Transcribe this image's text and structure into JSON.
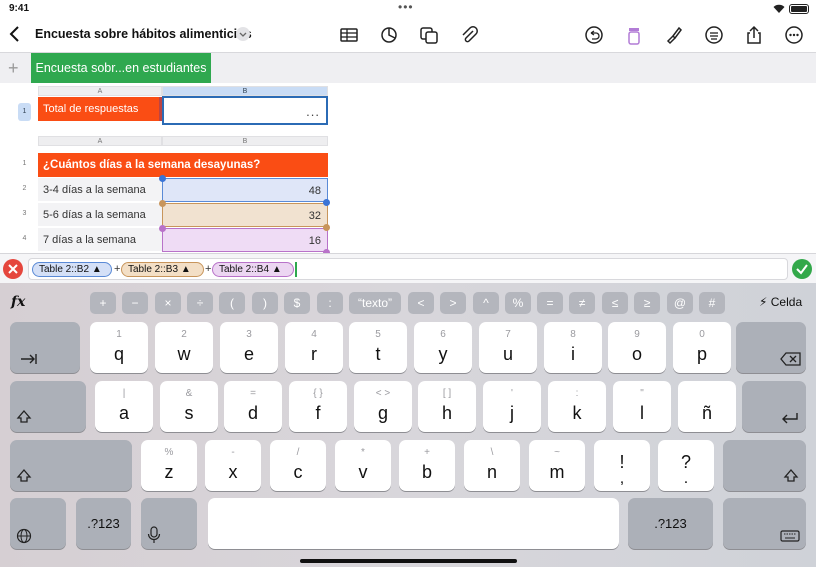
{
  "status": {
    "time": "9:41"
  },
  "toolbar": {
    "title": "Encuesta sobre hábitos alimenticios"
  },
  "sheet_tab": {
    "label": "Encuesta sobr...en estudiantes"
  },
  "table1": {
    "col_headers": [
      "A",
      "B"
    ],
    "row_header": "1",
    "label": "Total de respuestas",
    "value_placeholder": "..."
  },
  "table2": {
    "col_headers": [
      "A",
      "B"
    ],
    "header_row_num": "1",
    "header": "¿Cuántos días a la semana desayunas?",
    "rows": [
      {
        "num": "2",
        "label": "3-4 días a la semana",
        "value": "48"
      },
      {
        "num": "3",
        "label": "5-6 días a la semana",
        "value": "32"
      },
      {
        "num": "4",
        "label": "7 días a la semana",
        "value": "16"
      }
    ]
  },
  "formula": {
    "tokens": [
      "Table 2::B2",
      "Table 2::B3",
      "Table 2::B4"
    ],
    "operator": "+"
  },
  "shortcuts": {
    "keys": [
      "+",
      "−",
      "×",
      "÷",
      "(",
      ")",
      "$",
      ":",
      "“texto”",
      "<",
      ">",
      "^",
      "%",
      "=",
      "≠",
      "≤",
      "≥",
      "@",
      "#"
    ],
    "celda": "Celda"
  },
  "keyboard": {
    "row1": [
      {
        "sub": "1",
        "main": "q"
      },
      {
        "sub": "2",
        "main": "w"
      },
      {
        "sub": "3",
        "main": "e"
      },
      {
        "sub": "4",
        "main": "r"
      },
      {
        "sub": "5",
        "main": "t"
      },
      {
        "sub": "6",
        "main": "y"
      },
      {
        "sub": "7",
        "main": "u"
      },
      {
        "sub": "8",
        "main": "i"
      },
      {
        "sub": "9",
        "main": "o"
      },
      {
        "sub": "0",
        "main": "p"
      }
    ],
    "row2": [
      {
        "sub": "|",
        "main": "a"
      },
      {
        "sub": "&",
        "main": "s"
      },
      {
        "sub": "=",
        "main": "d"
      },
      {
        "sub": "{   }",
        "main": "f"
      },
      {
        "sub": "<   >",
        "main": "g"
      },
      {
        "sub": "[   ]",
        "main": "h"
      },
      {
        "sub": "'",
        "main": "j"
      },
      {
        "sub": ":",
        "main": "k"
      },
      {
        "sub": "\"",
        "main": "l"
      },
      {
        "sub": "",
        "main": "ñ"
      }
    ],
    "row3": [
      {
        "sub": "%",
        "main": "z"
      },
      {
        "sub": "-",
        "main": "x"
      },
      {
        "sub": "/",
        "main": "c"
      },
      {
        "sub": "*",
        "main": "v"
      },
      {
        "sub": "+",
        "main": "b"
      },
      {
        "sub": "\\",
        "main": "n"
      },
      {
        "sub": "~",
        "main": "m"
      },
      {
        "sub": "",
        "main": "!"
      },
      {
        "sub": "",
        "main": "?"
      }
    ],
    "row3_sub_excl": ",",
    "row3_sub_q": ".",
    "numbers_label": ".?123"
  }
}
